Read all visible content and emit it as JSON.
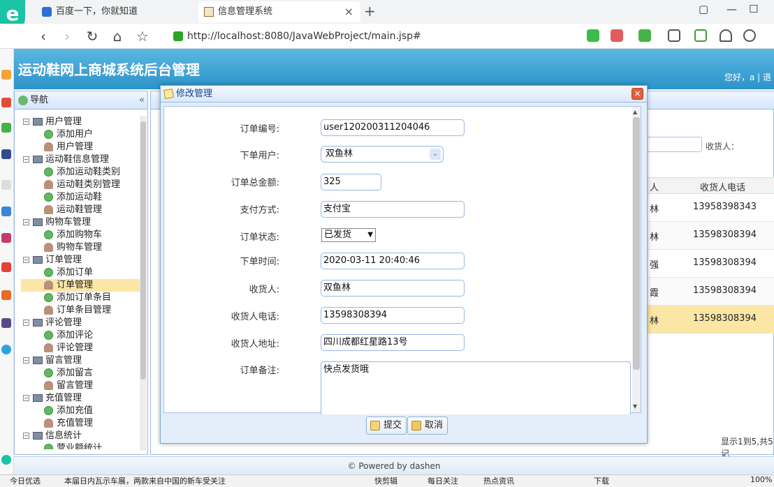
{
  "browser": {
    "tabs": [
      {
        "label": "百度一下，你就知道"
      },
      {
        "label": "信息管理系统"
      }
    ],
    "close_glyph": "×",
    "new_tab_glyph": "+",
    "url": "http://localhost:8080/JavaWebProject/main.jsp#"
  },
  "app": {
    "title": "运动鞋网上商城系统后台管理",
    "greeting": "您好，a | 退"
  },
  "sidebar": {
    "header": "导航",
    "collapse_glyph": "«",
    "tree": [
      {
        "label": "用户管理",
        "type": "parent"
      },
      {
        "label": "添加用户",
        "type": "add"
      },
      {
        "label": "用户管理",
        "type": "manage"
      },
      {
        "label": "运动鞋信息管理",
        "type": "parent"
      },
      {
        "label": "添加运动鞋类别",
        "type": "add"
      },
      {
        "label": "运动鞋类别管理",
        "type": "manage"
      },
      {
        "label": "添加运动鞋",
        "type": "add"
      },
      {
        "label": "运动鞋管理",
        "type": "manage"
      },
      {
        "label": "购物车管理",
        "type": "parent"
      },
      {
        "label": "添加购物车",
        "type": "add"
      },
      {
        "label": "购物车管理",
        "type": "manage"
      },
      {
        "label": "订单管理",
        "type": "parent"
      },
      {
        "label": "添加订单",
        "type": "add"
      },
      {
        "label": "订单管理",
        "type": "manage",
        "selected": true
      },
      {
        "label": "添加订单条目",
        "type": "add"
      },
      {
        "label": "订单条目管理",
        "type": "manage"
      },
      {
        "label": "评论管理",
        "type": "parent"
      },
      {
        "label": "添加评论",
        "type": "add"
      },
      {
        "label": "评论管理",
        "type": "manage"
      },
      {
        "label": "留言管理",
        "type": "parent"
      },
      {
        "label": "添加留言",
        "type": "add"
      },
      {
        "label": "留言管理",
        "type": "manage"
      },
      {
        "label": "充值管理",
        "type": "parent"
      },
      {
        "label": "添加充值",
        "type": "add"
      },
      {
        "label": "充值管理",
        "type": "manage"
      },
      {
        "label": "信息统计",
        "type": "parent"
      },
      {
        "label": "营业额统计",
        "type": "add"
      }
    ]
  },
  "background_grid": {
    "receiver_label": "收货人：",
    "columns": [
      "人",
      "收货人电话"
    ],
    "rows": [
      {
        "a": "林",
        "b": "13958398343"
      },
      {
        "a": "林",
        "b": "13598308394"
      },
      {
        "a": "强",
        "b": "13598308394"
      },
      {
        "a": "霞",
        "b": "13598308394"
      },
      {
        "a": "林",
        "b": "13598308394"
      }
    ],
    "pager_text": "显示1到5,共5记"
  },
  "footer": "© Powered by dashen",
  "modal": {
    "title": "修改管理",
    "close_glyph": "×",
    "fields": {
      "order_no": {
        "label": "订单编号:",
        "value": "user120200311204046"
      },
      "user": {
        "label": "下单用户:",
        "value": "双鱼林",
        "arrow": "⌄"
      },
      "total": {
        "label": "订单总金额:",
        "value": "325"
      },
      "payment": {
        "label": "支付方式:",
        "value": "支付宝"
      },
      "status": {
        "label": "订单状态:",
        "value": "已发货",
        "arrow": "▼"
      },
      "order_time": {
        "label": "下单时间:",
        "value": "2020-03-11 20:40:46"
      },
      "receiver": {
        "label": "收货人:",
        "value": "双鱼林"
      },
      "receiver_phone": {
        "label": "收货人电话:",
        "value": "13598308394"
      },
      "receiver_address": {
        "label": "收货人地址:",
        "value": "四川成都红星路13号"
      },
      "remark": {
        "label": "订单备注:",
        "value": "快点发货哦"
      }
    },
    "buttons": {
      "submit": "提交",
      "cancel": "取消"
    }
  },
  "statusbar": {
    "items": [
      "今日优选",
      "本届日内瓦示车展，两款来自中国的新车受关注",
      "快剪辑",
      "每日关注",
      "热点资讯",
      "下载",
      "100%"
    ]
  },
  "colors": {
    "header_blue": "#2c93c9",
    "panel_border": "#99bbe8",
    "selected_row": "#fbe6a6"
  }
}
